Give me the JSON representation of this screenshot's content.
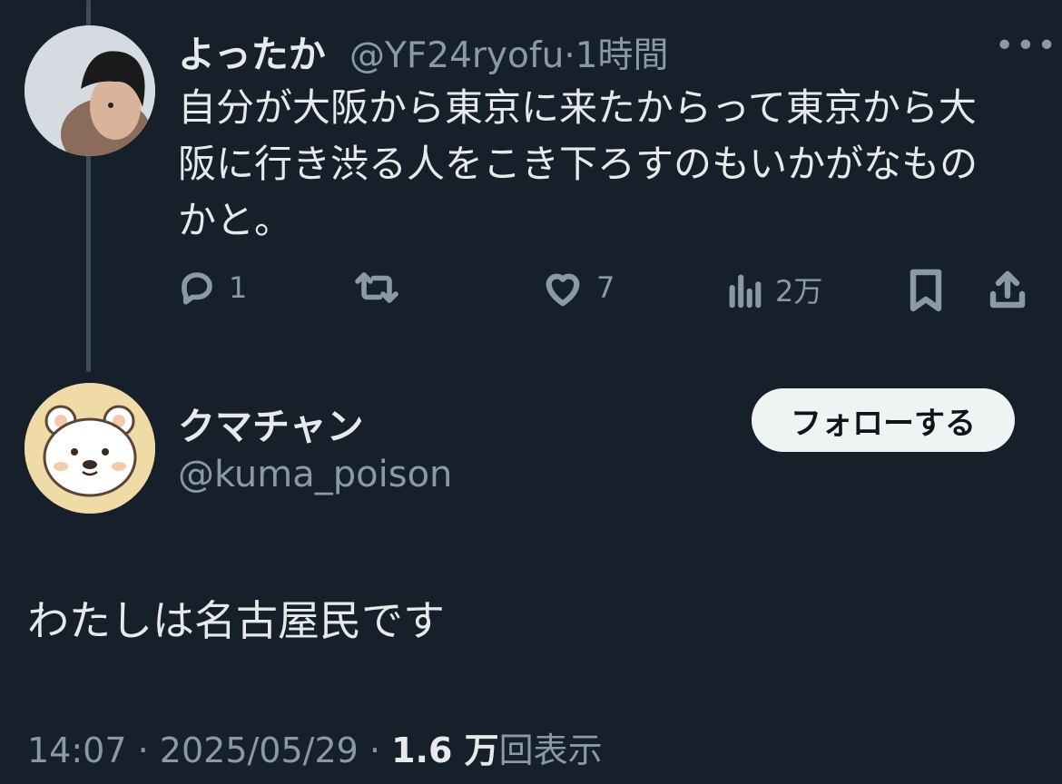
{
  "tweet": {
    "author_name": "よったか",
    "author_handle": "@YF24ryofu",
    "separator": "·",
    "time_ago": "1時間",
    "more": "•••",
    "text": "自分が大阪から東京に来たからって東京から大阪に行き渋る人をこき下ろすのもいかがなものかと。",
    "actions": {
      "reply_count": "1",
      "retweet_count": "",
      "like_count": "7",
      "views_count": "2万"
    }
  },
  "reply": {
    "author_name": "クマチャン",
    "author_handle": "@kuma_poison",
    "follow_label": "フォローする",
    "text": "わたしは名古屋民です",
    "meta": {
      "time": "14:07",
      "dot": "·",
      "date": "2025/05/29",
      "views_number": "1.6 万",
      "views_label": "回表示"
    }
  },
  "colors": {
    "background": "#15202b",
    "primary_text": "#e7e9ea",
    "muted_text": "#8b98a5",
    "follow_bg": "#eff3f4"
  }
}
